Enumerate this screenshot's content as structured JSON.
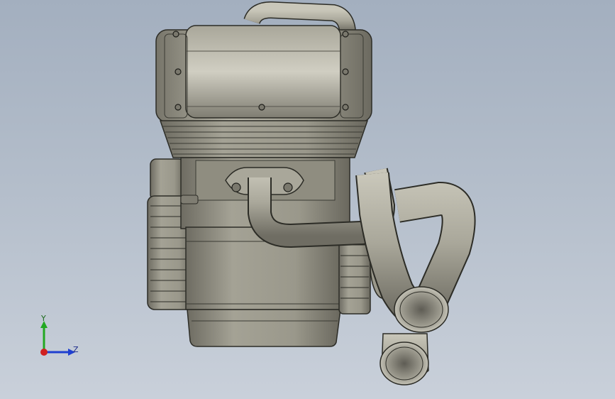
{
  "viewport": {
    "background_top": "#a3afbf",
    "background_bottom": "#c9d0da",
    "model_color": "#8f8d7f",
    "edge_color": "#2c2c26"
  },
  "triad": {
    "y_label": "Y",
    "z_label": "Z",
    "y_color": "#22a822",
    "z_color": "#1f3fd0",
    "x_color": "#d02020"
  }
}
